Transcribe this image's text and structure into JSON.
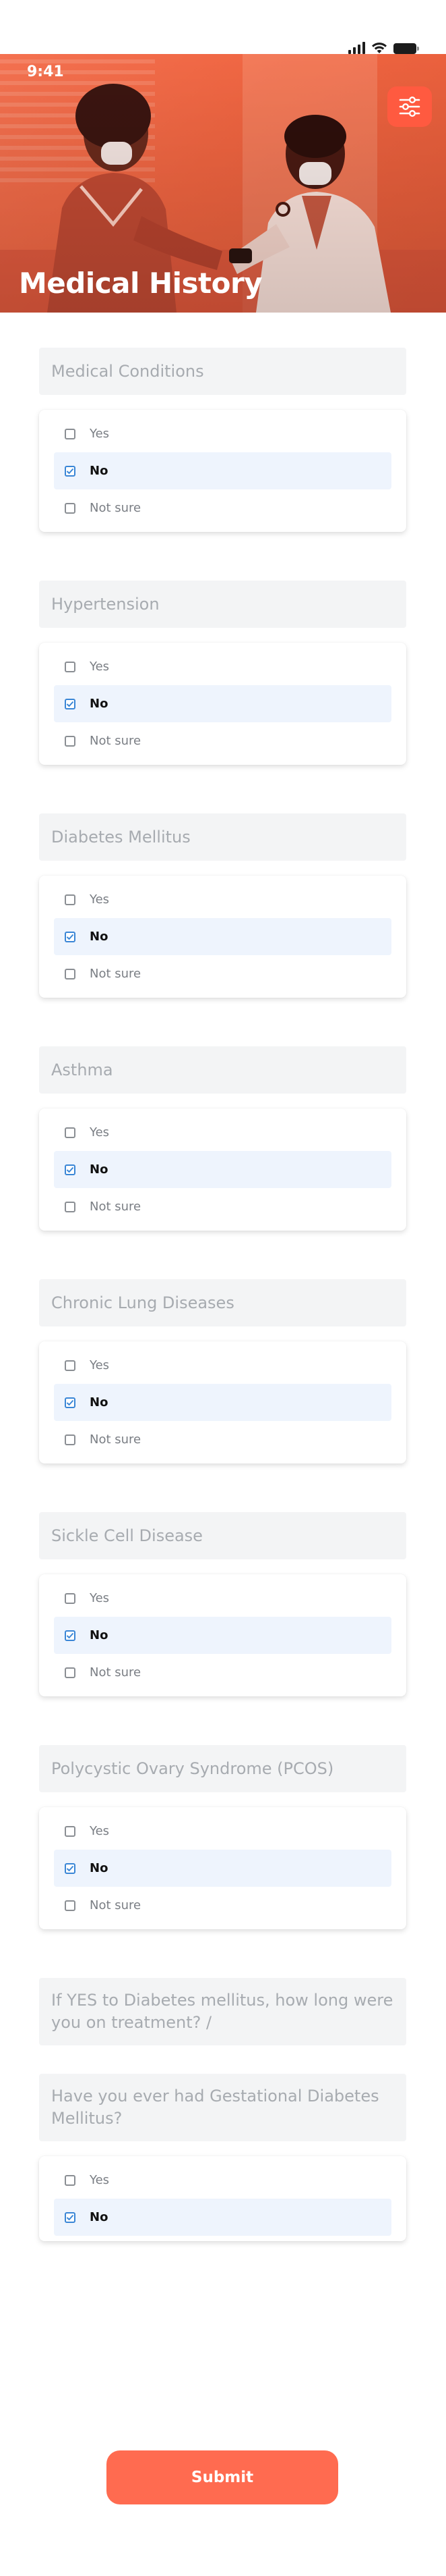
{
  "status_bar": {
    "time": "9:41"
  },
  "header": {
    "title": "Medical History",
    "filter_icon": "sliders-icon"
  },
  "options": {
    "yes": "Yes",
    "no": "No",
    "not_sure": "Not sure"
  },
  "questions": [
    {
      "label": "Medical Conditions",
      "selected": "No"
    },
    {
      "label": "Hypertension",
      "selected": "No"
    },
    {
      "label": "Diabetes Mellitus",
      "selected": "No"
    },
    {
      "label": "Asthma",
      "selected": "No"
    },
    {
      "label": "Chronic Lung Diseases",
      "selected": "No"
    },
    {
      "label": "Sickle Cell Disease",
      "selected": "No"
    },
    {
      "label": "Polycystic Ovary Syndrome (PCOS)",
      "selected": "No"
    }
  ],
  "diabetes_treatment_question": {
    "placeholder": "If YES to Diabetes mellitus, how long were you on treatment? /"
  },
  "gestational_question": {
    "label": "Have you ever had Gestational Diabetes Mellitus?",
    "options": [
      "Yes",
      "No"
    ],
    "selected": "No"
  },
  "submit": {
    "label": "Submit"
  },
  "colors": {
    "accent": "#ff6b50",
    "hero_tint": "#f06a48",
    "checkbox_checked": "#3a86d6",
    "selected_row": "#eef4fd"
  }
}
